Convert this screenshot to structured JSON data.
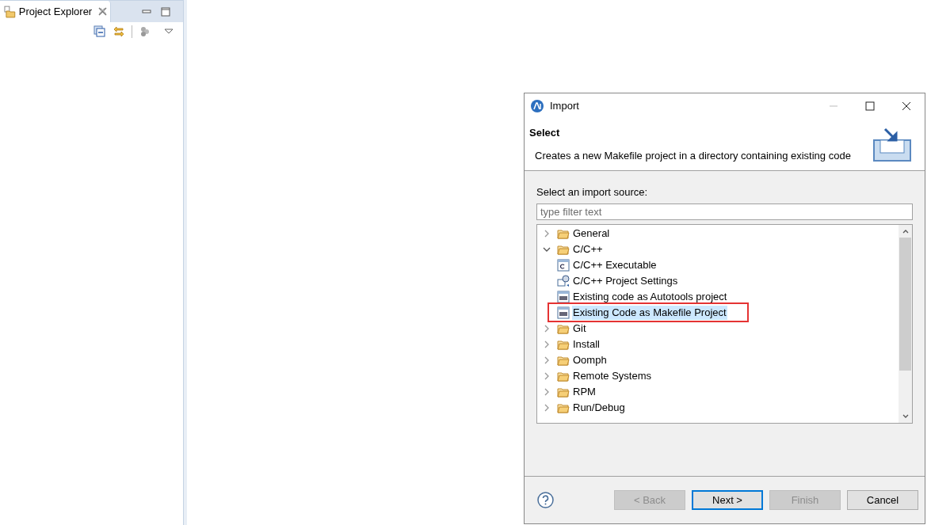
{
  "explorer": {
    "tab": {
      "label": "Project Explorer"
    }
  },
  "dialog": {
    "title": "Import",
    "header": {
      "title": "Select",
      "description": "Creates a new Makefile project in a directory containing existing code"
    },
    "source_label": "Select an import source:",
    "filter": {
      "placeholder": "type filter text"
    },
    "tree": [
      {
        "label": "General",
        "kind": "folder",
        "expanded": false
      },
      {
        "label": "C/C++",
        "kind": "folder",
        "expanded": true,
        "children": [
          {
            "label": "C/C++ Executable",
            "kind": "c-file",
            "selected": false,
            "marked": false
          },
          {
            "label": "C/C++ Project Settings",
            "kind": "settings",
            "selected": false,
            "marked": false
          },
          {
            "label": "Existing code as Autotools project",
            "kind": "cpp-file",
            "selected": false,
            "marked": false
          },
          {
            "label": "Existing Code as Makefile Project",
            "kind": "cpp-file",
            "selected": true,
            "marked": true
          }
        ]
      },
      {
        "label": "Git",
        "kind": "folder",
        "expanded": false
      },
      {
        "label": "Install",
        "kind": "folder",
        "expanded": false
      },
      {
        "label": "Oomph",
        "kind": "folder",
        "expanded": false
      },
      {
        "label": "Remote Systems",
        "kind": "folder",
        "expanded": false
      },
      {
        "label": "RPM",
        "kind": "folder",
        "expanded": false
      },
      {
        "label": "Run/Debug",
        "kind": "folder",
        "expanded": false
      }
    ],
    "buttons": [
      {
        "label": "< Back",
        "disabled": true,
        "default": false
      },
      {
        "label": "Next >",
        "disabled": false,
        "default": true
      },
      {
        "label": "Finish",
        "disabled": true,
        "default": false
      },
      {
        "label": "Cancel",
        "disabled": false,
        "default": false
      }
    ]
  }
}
